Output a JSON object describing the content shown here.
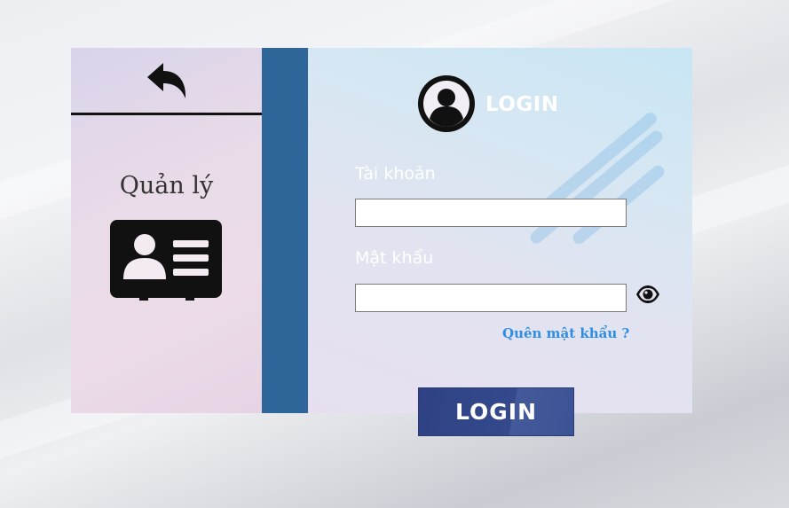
{
  "left_panel": {
    "manage_label": "Quản lý",
    "back_icon": "back-arrow-icon",
    "card_icon": "id-card-icon"
  },
  "login_form": {
    "title": "LOGIN",
    "avatar_icon": "user-circle-icon",
    "username_label": "Tài khoản",
    "username_value": "",
    "password_label": "Mật khẩu",
    "password_value": "",
    "show_password_icon": "eye-icon",
    "forgot_password": "Quên mật khẩu ?",
    "submit_label": "LOGIN"
  },
  "colors": {
    "stripe": "#2f6699",
    "button": "#34498c",
    "link": "#2d8fe4"
  }
}
